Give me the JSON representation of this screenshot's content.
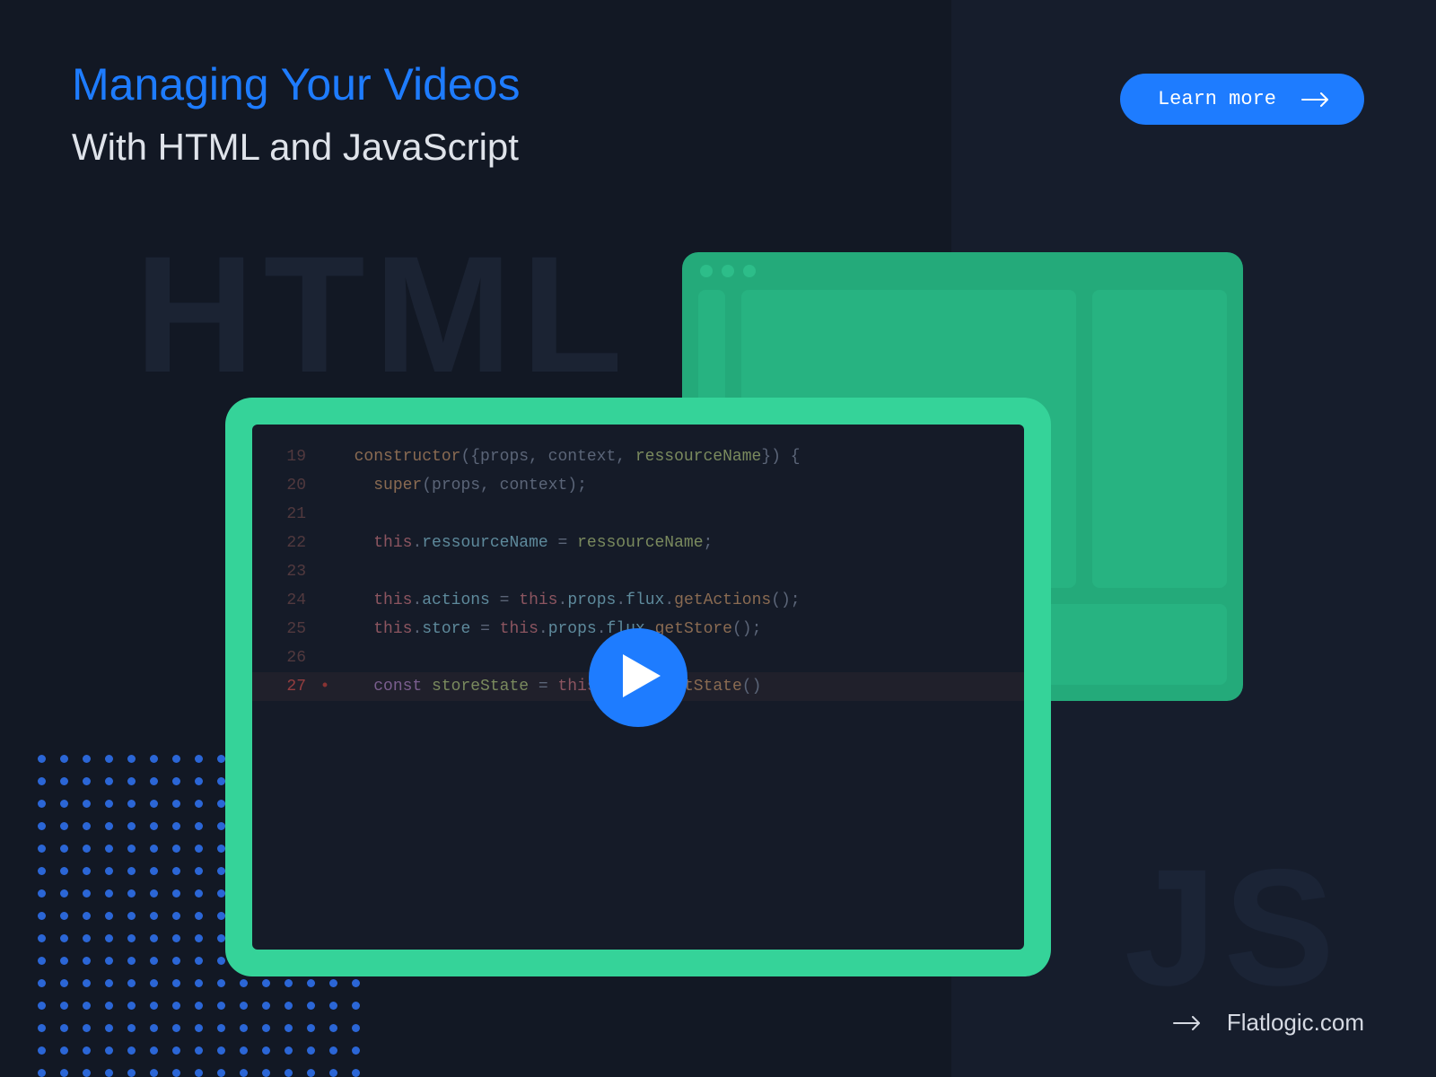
{
  "header": {
    "title": "Managing Your Videos",
    "subtitle": "With HTML and JavaScript",
    "cta": "Learn more"
  },
  "background": {
    "html_text": "HTML",
    "js_text": "JS"
  },
  "code": {
    "lines": [
      {
        "num": "19",
        "text": "constructor({props, context, ressourceName}) {"
      },
      {
        "num": "20",
        "text": "  super(props, context);"
      },
      {
        "num": "21",
        "text": ""
      },
      {
        "num": "22",
        "text": "  this.ressourceName = ressourceName;"
      },
      {
        "num": "23",
        "text": ""
      },
      {
        "num": "24",
        "text": "  this.actions = this.props.flux.getActions();"
      },
      {
        "num": "25",
        "text": "  this.store = this.props.flux.getStore();"
      },
      {
        "num": "26",
        "text": ""
      },
      {
        "num": "27",
        "text": "  const storeState = this.store.getState()"
      }
    ]
  },
  "footer": {
    "link": "Flatlogic.com"
  }
}
